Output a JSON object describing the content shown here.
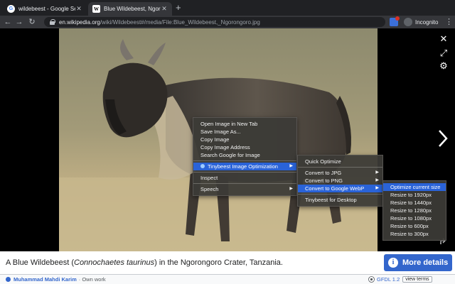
{
  "browser": {
    "tabs": [
      {
        "title": "wildebeest - Google Search",
        "favicon": "G",
        "active": false
      },
      {
        "title": "Blue Wildebeest, Ngorongoro",
        "favicon": "W",
        "active": true
      }
    ],
    "url_host": "en.wikipedia.org",
    "url_path": "/wiki/Wildebeest#/media/File:Blue_Wildebeest,_Ngorongoro.jpg",
    "profile_label": "Incognito"
  },
  "context_menu": {
    "items": [
      "Open Image in New Tab",
      "Save Image As...",
      "Copy Image",
      "Copy Image Address",
      "Search Google for Image"
    ],
    "extension_item": "Tinybeest Image Optimization",
    "inspect": "Inspect",
    "speech": "Speech"
  },
  "submenu": {
    "quick": "Quick Optimize",
    "jpg": "Convert to JPG",
    "png": "Convert to PNG",
    "webp": "Convert to Google WebP",
    "desktop": "Tinybeest for Desktop"
  },
  "webp_menu": {
    "optimize": "Optimize current size",
    "sizes": [
      "Resize to 1920px",
      "Resize to 1440px",
      "Resize to 1280px",
      "Resize to 1080px",
      "Resize to 600px",
      "Resize to 300px"
    ]
  },
  "caption": {
    "prefix": "A Blue Wildebeest (",
    "species": "Connochaetes taurinus",
    "suffix": ") in the Ngorongoro Crater, Tanzania."
  },
  "more_details": "More details",
  "credit": {
    "author": "Muhammad Mahdi Karim",
    "source": "· Own work"
  },
  "license": {
    "name": "GFDL 1.2",
    "terms": "view terms"
  },
  "colors": {
    "menu_highlight": "#2a63d8",
    "wiki_blue": "#3366cc",
    "chrome_dark": "#202124"
  }
}
